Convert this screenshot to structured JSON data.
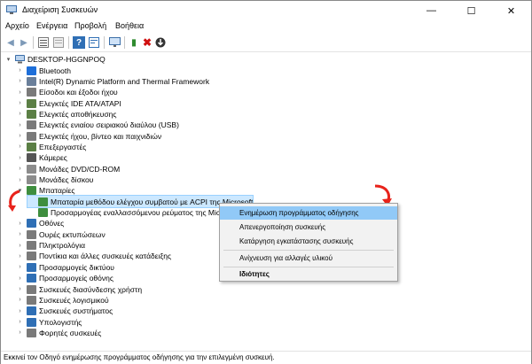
{
  "window": {
    "title": "Διαχείριση Συσκευών",
    "minimize": "—",
    "maximize": "☐",
    "close": "✕"
  },
  "menu": [
    "Αρχείο",
    "Ενέργεια",
    "Προβολή",
    "Βοήθεια"
  ],
  "tree": {
    "root": "DESKTOP-HGGNPOQ",
    "items": [
      {
        "label": "Bluetooth",
        "color": "#1e6fd9"
      },
      {
        "label": "Intel(R) Dynamic Platform and Thermal Framework",
        "color": "#6a7f9a"
      },
      {
        "label": "Είσοδοι και έξοδοι ήχου",
        "color": "#7a7a7a"
      },
      {
        "label": "Ελεγκτές IDE ATA/ATAPI",
        "color": "#5b7f45"
      },
      {
        "label": "Ελεγκτές αποθήκευσης",
        "color": "#5b7f45"
      },
      {
        "label": "Ελεγκτές ενιαίου σειριακού διαύλου (USB)",
        "color": "#7a7a7a"
      },
      {
        "label": "Ελεγκτές ήχου, βίντεο και παιχνιδιών",
        "color": "#7a7a7a"
      },
      {
        "label": "Επεξεργαστές",
        "color": "#5b7f45"
      },
      {
        "label": "Κάμερες",
        "color": "#555555"
      },
      {
        "label": "Μονάδες DVD/CD-ROM",
        "color": "#8c8c8c"
      },
      {
        "label": "Μονάδες δίσκου",
        "color": "#8c8c8c"
      },
      {
        "label": "Μπαταρίες",
        "color": "#3e8e3e"
      },
      {
        "label": "Μπαταρία μεθόδου ελέγχου συμβατού με ACPI της Microsoft",
        "color": "#3e8e3e"
      },
      {
        "label": "Προσαρμογέας εναλλασσόμενου ρεύματος της Mic",
        "color": "#3e8e3e"
      },
      {
        "label": "Οθόνες",
        "color": "#2f6fb5"
      },
      {
        "label": "Ουρές εκτυπώσεων",
        "color": "#7a7a7a"
      },
      {
        "label": "Πληκτρολόγια",
        "color": "#7a7a7a"
      },
      {
        "label": "Ποντίκια και άλλες συσκευές κατάδειξης",
        "color": "#7a7a7a"
      },
      {
        "label": "Προσαρμογείς δικτύου",
        "color": "#2f6fb5"
      },
      {
        "label": "Προσαρμογείς οθόνης",
        "color": "#2f6fb5"
      },
      {
        "label": "Συσκευές διασύνδεσης χρήστη",
        "color": "#7a7a7a"
      },
      {
        "label": "Συσκευές λογισμικού",
        "color": "#7a7a7a"
      },
      {
        "label": "Συσκευές συστήματος",
        "color": "#2f6fb5"
      },
      {
        "label": "Υπολογιστής",
        "color": "#2f6fb5"
      },
      {
        "label": "Φορητές συσκευές",
        "color": "#7a7a7a"
      }
    ]
  },
  "context_menu": {
    "update": "Ενημέρωση προγράμματος οδήγησης",
    "disable": "Απενεργοποίηση συσκευής",
    "uninstall": "Κατάργηση εγκατάστασης συσκευής",
    "scan": "Ανίχνευση για αλλαγές υλικού",
    "properties": "Ιδιότητες"
  },
  "status": "Εκκινεί τον Οδηγό ενημέρωσης προγράμματος οδήγησης για την επιλεγμένη συσκευή.",
  "colors": {
    "accent": "#cce8ff",
    "menu_highlight": "#91c9f7",
    "arrow": "#e8231b"
  }
}
